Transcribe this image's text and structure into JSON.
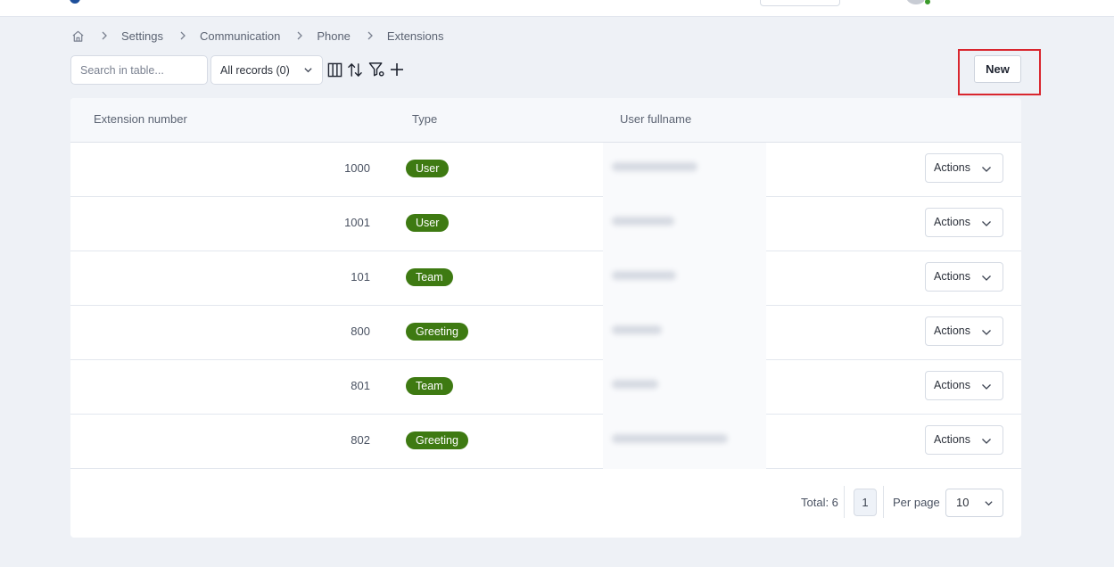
{
  "breadcrumb": {
    "items": [
      "Settings",
      "Communication",
      "Phone",
      "Extensions"
    ]
  },
  "toolbar": {
    "search_placeholder": "Search in table...",
    "records_filter": "All records (0)",
    "new_label": "New",
    "icons": [
      "columns-icon",
      "sort-icon",
      "filter-settings-icon",
      "plus-icon"
    ]
  },
  "table": {
    "headers": {
      "extension": "Extension number",
      "type": "Type",
      "user_fullname": "User fullname"
    },
    "rows": [
      {
        "extension": "1000",
        "type": "User",
        "actions": "Actions"
      },
      {
        "extension": "1001",
        "type": "User",
        "actions": "Actions"
      },
      {
        "extension": "101",
        "type": "Team",
        "actions": "Actions"
      },
      {
        "extension": "800",
        "type": "Greeting",
        "actions": "Actions"
      },
      {
        "extension": "801",
        "type": "Team",
        "actions": "Actions"
      },
      {
        "extension": "802",
        "type": "Greeting",
        "actions": "Actions"
      }
    ]
  },
  "pagination": {
    "total": "Total: 6",
    "current_page": "1",
    "per_page_label": "Per page",
    "per_page_value": "10"
  },
  "colors": {
    "badge": "#3e7a12",
    "highlight": "#d9262e",
    "background": "#eef1f6"
  }
}
